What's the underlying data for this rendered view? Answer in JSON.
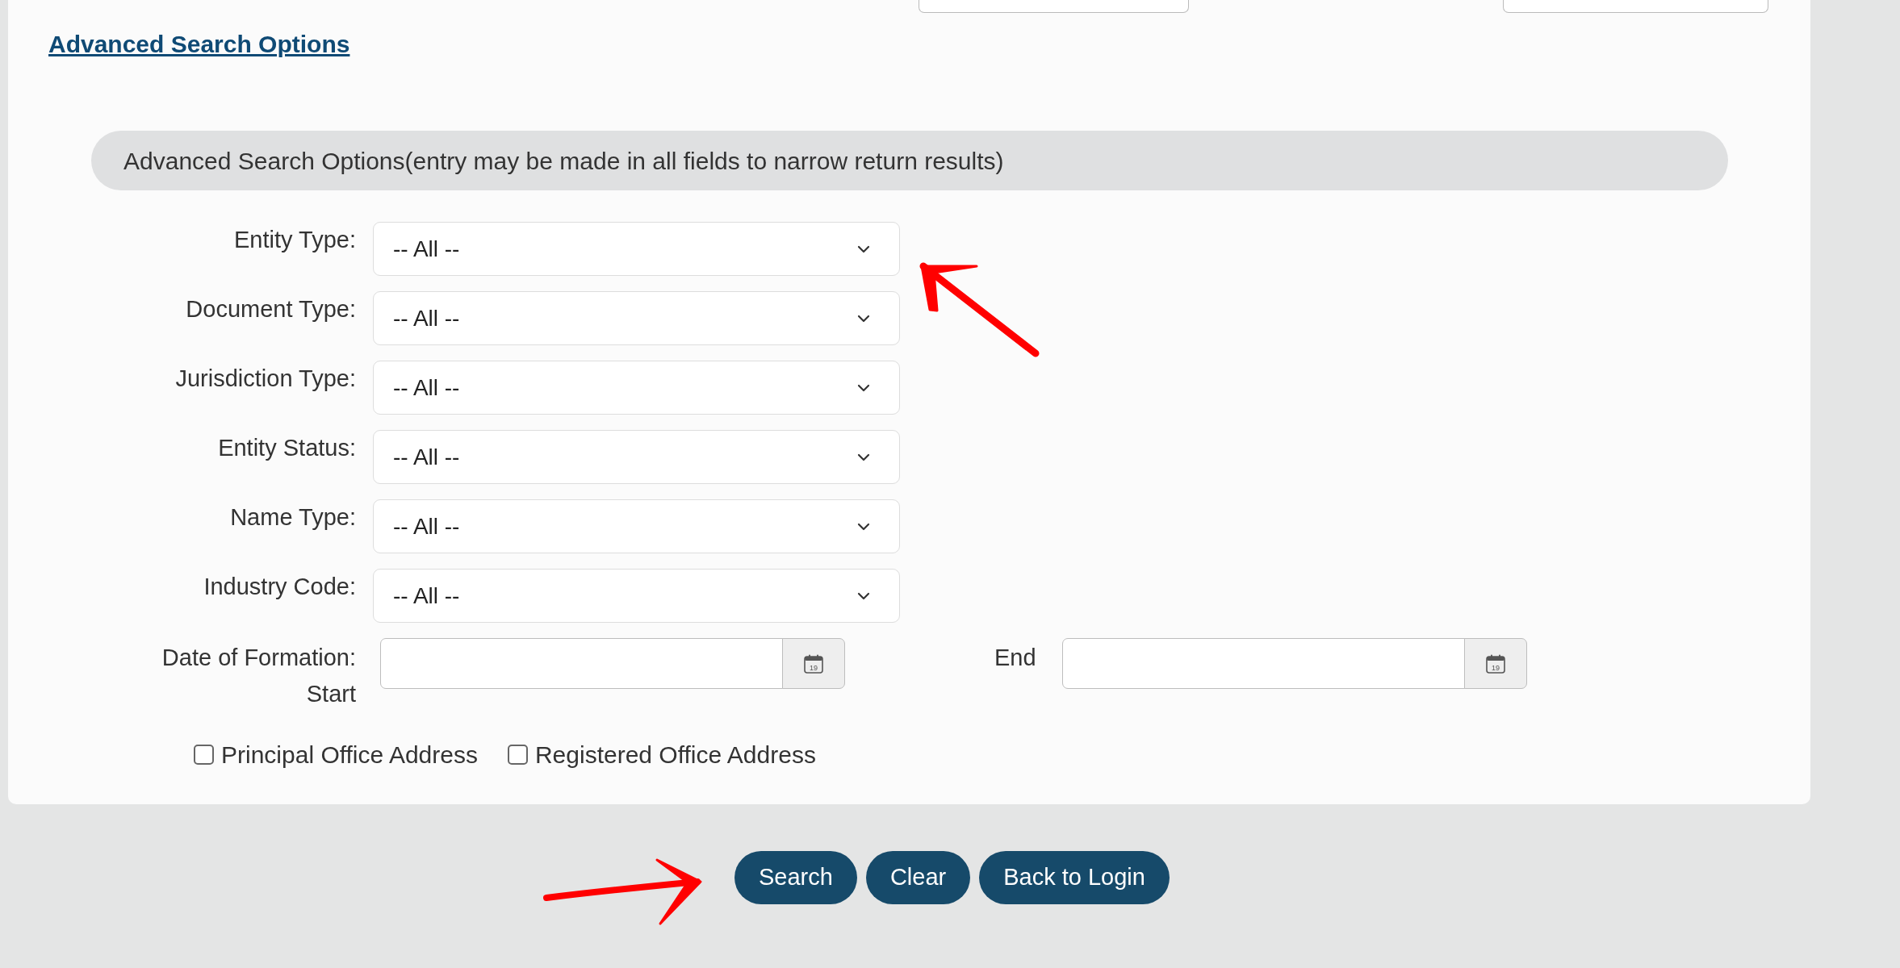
{
  "advanced_link": "Advanced Search Options",
  "section_banner": "Advanced Search Options(entry may be made in all fields to narrow return results)",
  "filters": [
    {
      "label": "Entity Type:",
      "value": "-- All --"
    },
    {
      "label": "Document Type:",
      "value": "-- All --"
    },
    {
      "label": "Jurisdiction Type:",
      "value": "-- All --"
    },
    {
      "label": "Entity Status:",
      "value": "-- All --"
    },
    {
      "label": "Name Type:",
      "value": "-- All --"
    },
    {
      "label": "Industry Code:",
      "value": "-- All --"
    }
  ],
  "date_of_formation": {
    "start_label": "Date of Formation: Start",
    "end_label": "End",
    "start_calendar_text": "19",
    "end_calendar_text": "19"
  },
  "checkboxes": [
    {
      "label": "Principal Office Address",
      "checked": false
    },
    {
      "label": "Registered Office Address",
      "checked": false
    }
  ],
  "buttons": [
    "Search",
    "Clear",
    "Back to Login"
  ]
}
